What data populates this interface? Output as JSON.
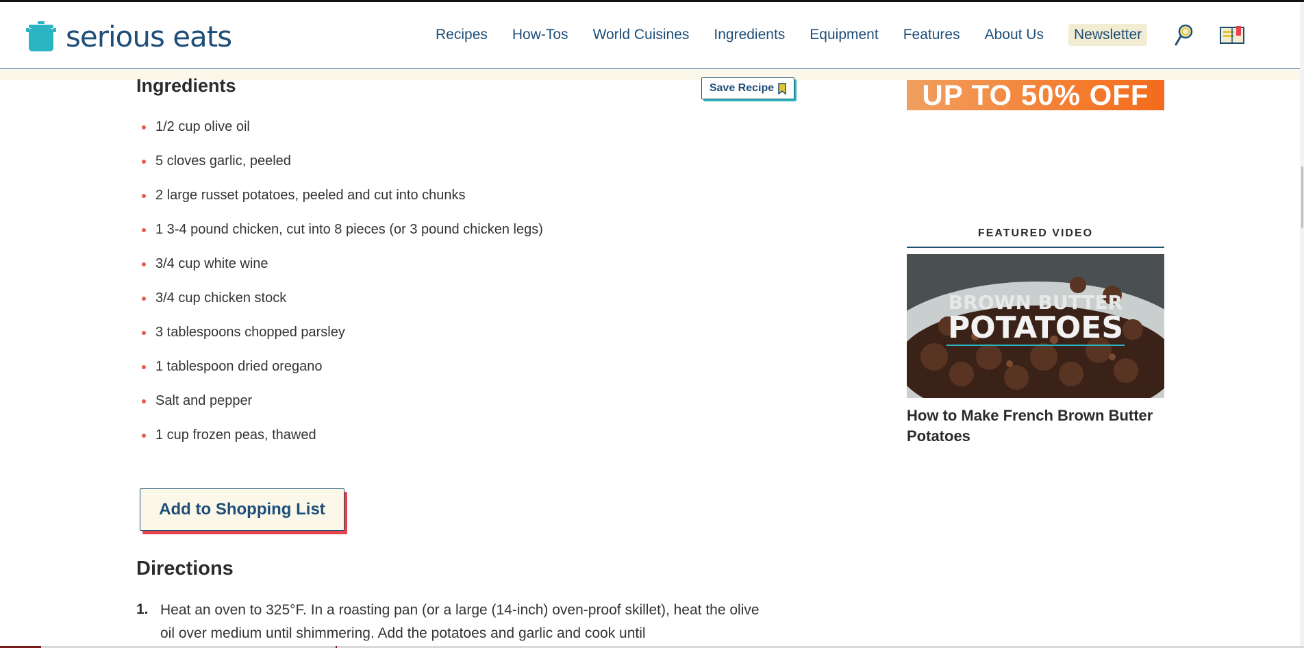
{
  "header": {
    "logo_text": "serious eats",
    "nav": [
      "Recipes",
      "How-Tos",
      "World Cuisines",
      "Ingredients",
      "Equipment",
      "Features",
      "About Us"
    ],
    "newsletter_label": "Newsletter",
    "search_icon": "search-icon",
    "saved_icon": "saved-recipes-icon"
  },
  "ingredients": {
    "heading": "Ingredients",
    "save_recipe_label": "Save Recipe",
    "items": [
      "1/2 cup olive oil",
      "5 cloves garlic, peeled",
      "2 large russet potatoes, peeled and cut into chunks",
      "1 3-4 pound chicken, cut into 8 pieces (or 3 pound chicken legs)",
      "3/4 cup white wine",
      "3/4 cup chicken stock",
      "3 tablespoons chopped parsley",
      "1 tablespoon dried oregano",
      "Salt and pepper",
      "1 cup frozen peas, thawed"
    ],
    "shopping_list_label": "Add to Shopping List"
  },
  "directions": {
    "heading": "Directions",
    "step1_number": "1.",
    "step1_text": "Heat an oven to 325°F. In a roasting pan (or a large (14-inch) oven-proof skillet), heat the olive oil over medium until shimmering. Add the potatoes and garlic and cook until"
  },
  "sidebar": {
    "ad_text": "UP TO 50% OFF",
    "featured_label": "FEATURED VIDEO",
    "video_overlay_line1": "BROWN BUTTER",
    "video_overlay_line2": "POTATOES",
    "video_title": "How to Make French Brown Butter Potatoes"
  },
  "colors": {
    "brand_blue": "#1f4e79",
    "brand_teal": "#2bb5c2",
    "accent_red": "#e8424f",
    "cream": "#fbf7e9"
  }
}
